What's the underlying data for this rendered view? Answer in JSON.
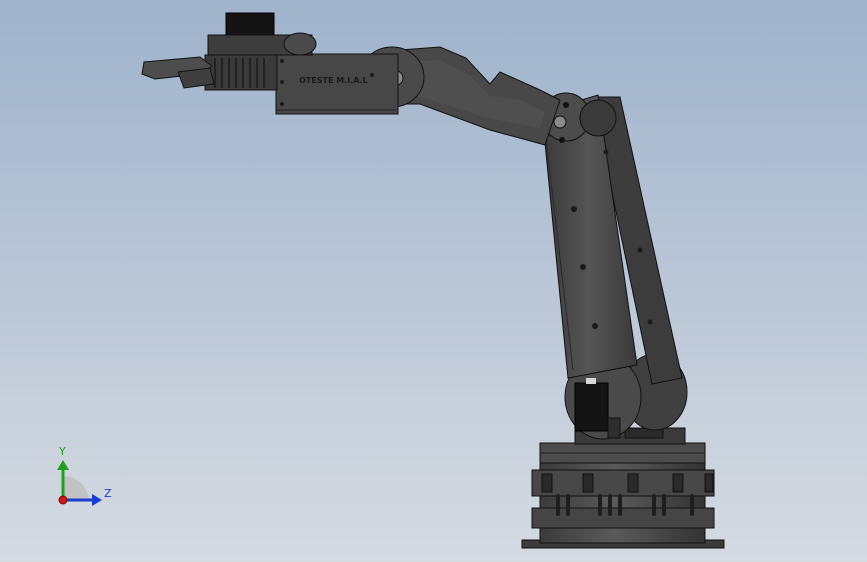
{
  "viewport": {
    "background_top": "#9fb3cc",
    "background_bottom": "#d6dbe2"
  },
  "model": {
    "part_color": "#4a4a4a",
    "part_dark": "#2c2c2c",
    "part_light": "#6a6a6a",
    "engraving_text": "OTESTE M.I.A.L"
  },
  "triad": {
    "y_label": "Y",
    "z_label": "Z",
    "y_color": "#1fa01f",
    "z_color": "#1a3fd1",
    "x_color": "#c81d1d"
  }
}
